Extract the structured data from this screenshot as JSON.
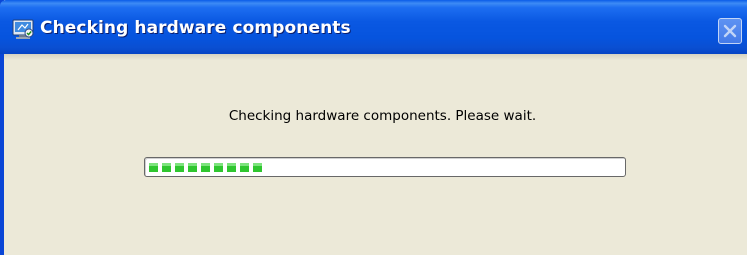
{
  "window": {
    "title": "Checking hardware components",
    "icon": "hardware-check-icon"
  },
  "controls": {
    "close_icon": "close-icon"
  },
  "content": {
    "message": "Checking hardware components. Please wait."
  },
  "progress": {
    "segments_filled": 9,
    "fraction": 0.25,
    "color": "#2fc62f"
  },
  "colors": {
    "titlebar": "#0a58e2",
    "window_background": "#ece9d8",
    "progress_segment": "#2fc62f"
  }
}
